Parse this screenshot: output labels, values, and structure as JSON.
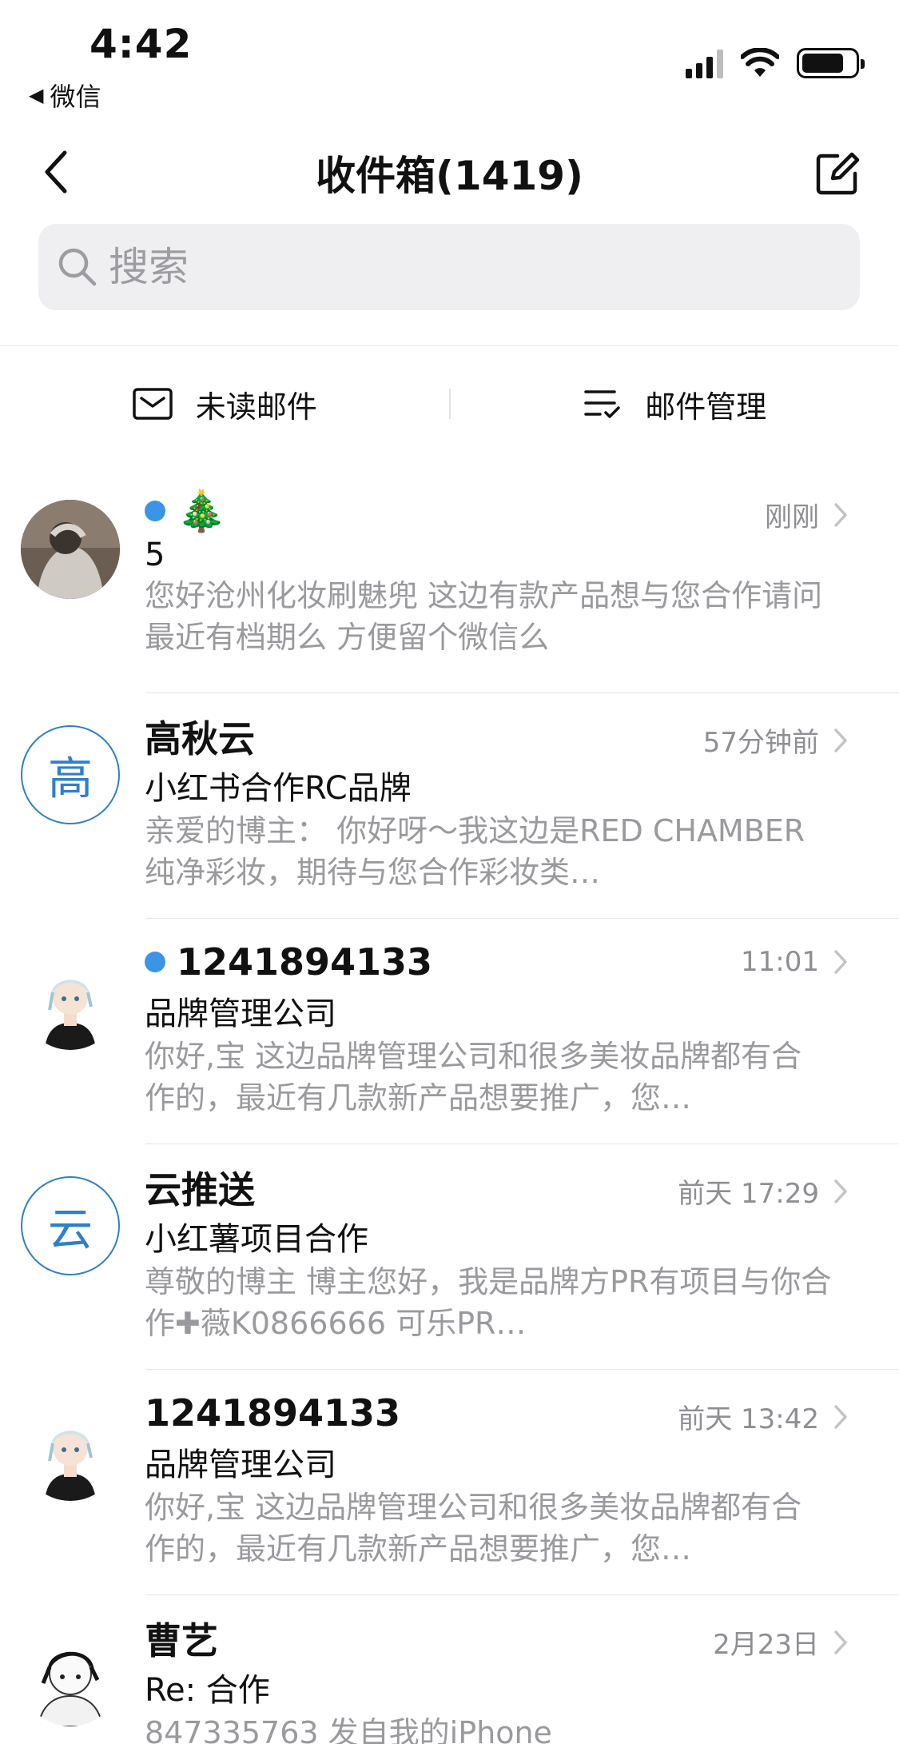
{
  "status": {
    "time": "4:42",
    "back_app": "微信",
    "back_arrow": "◀"
  },
  "nav": {
    "title": "收件箱(1419)"
  },
  "search": {
    "placeholder": "搜索"
  },
  "toolbar": {
    "unread_label": "未读邮件",
    "manage_label": "邮件管理"
  },
  "mails": [
    {
      "sender": "🎄",
      "unread": true,
      "time": "刚刚",
      "subject": "5",
      "preview": "您好沧州化妆刷魅兜 这边有款产品想与您合作请问最近有档期么 方便留个微信么",
      "avatar_type": "photo"
    },
    {
      "sender": "高秋云",
      "unread": false,
      "time": "57分钟前",
      "subject": "小红书合作RC品牌",
      "preview": "亲爱的博主：  你好呀～我这边是RED CHAMBER纯净彩妆，期待与您合作彩妆类…",
      "avatar_type": "letter",
      "avatar_letter": "高"
    },
    {
      "sender": "1241894133",
      "unread": true,
      "time": "11:01",
      "subject": "品牌管理公司",
      "preview": "你好,宝  这边品牌管理公司和很多美妆品牌都有合作的，最近有几款新产品想要推广，您…",
      "avatar_type": "anime"
    },
    {
      "sender": "云推送",
      "unread": false,
      "time": "前天 17:29",
      "subject": "小红薯项目合作",
      "preview": "尊敬的博主          博主您好，我是品牌方PR有项目与你合作✚薇K0866666      可乐PR…",
      "avatar_type": "letter",
      "avatar_letter": "云"
    },
    {
      "sender": "1241894133",
      "unread": false,
      "time": "前天 13:42",
      "subject": "品牌管理公司",
      "preview": "你好,宝  这边品牌管理公司和很多美妆品牌都有合作的，最近有几款新产品想要推广，您…",
      "avatar_type": "anime"
    },
    {
      "sender": "曹艺",
      "unread": false,
      "time": "2月23日",
      "subject": "Re: 合作",
      "preview": "847335763 发自我的iPhone",
      "avatar_type": "bw"
    }
  ],
  "colors": {
    "accent": "#3a95e6",
    "letter_avatar": "#2f80c9",
    "secondary_text": "#9a9a9e",
    "search_bg": "#efeff1"
  }
}
